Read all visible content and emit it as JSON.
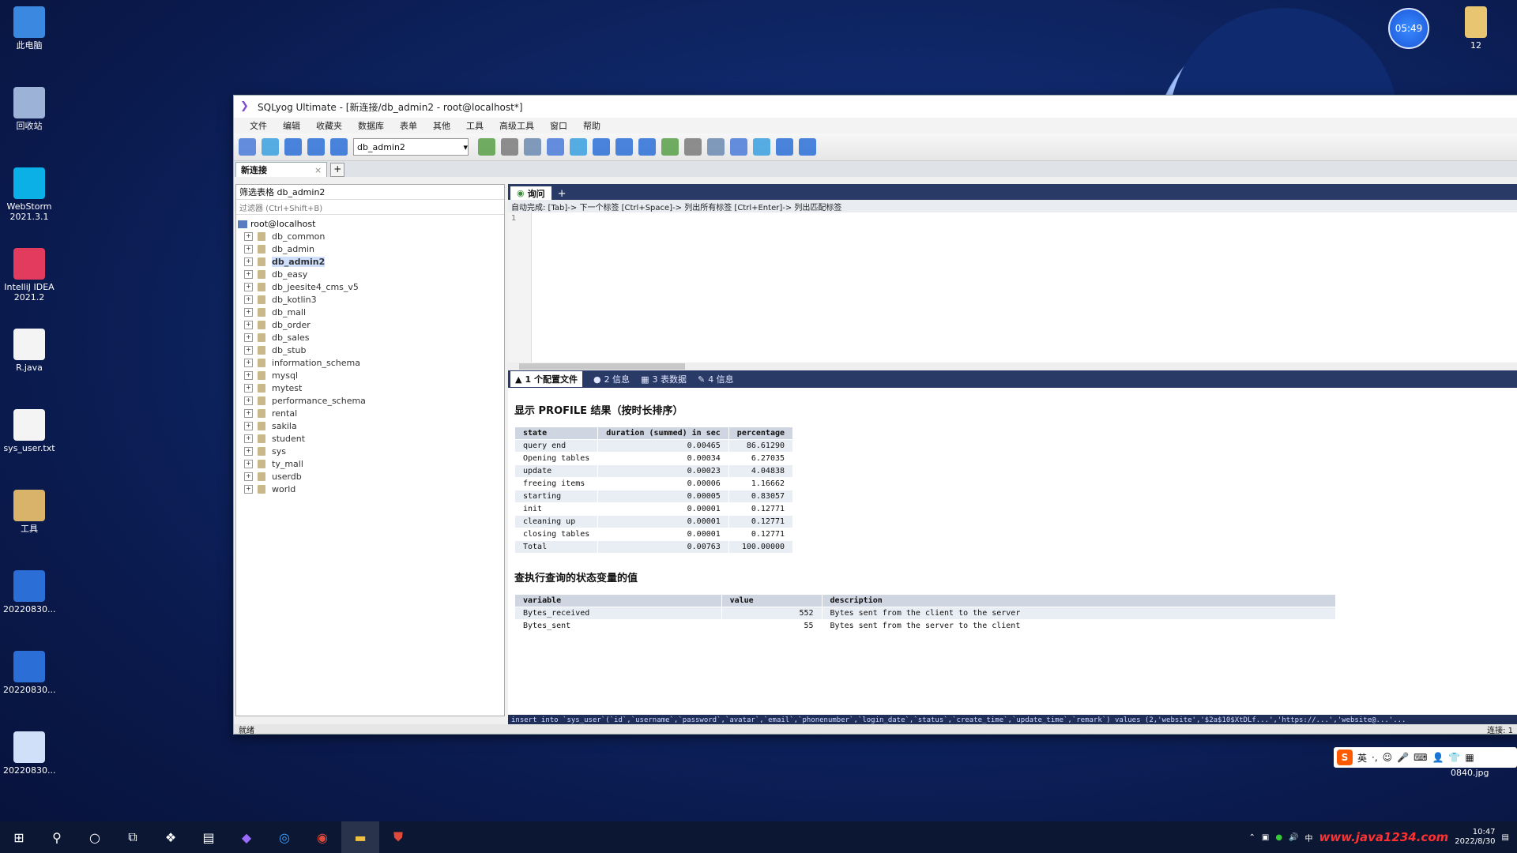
{
  "desktop": {
    "icons": [
      {
        "label": "此电脑",
        "color": "#3a88e0"
      },
      {
        "label": "回收站",
        "color": "#9cb2d6"
      },
      {
        "label": "WebStorm 2021.3.1",
        "color": "#0bb0e6"
      },
      {
        "label": "IntelliJ IDEA 2021.2",
        "color": "#e23b5d"
      },
      {
        "label": "R.java",
        "color": "#f4f4f4"
      },
      {
        "label": "sys_user.txt",
        "color": "#f4f4f4"
      },
      {
        "label": "工具",
        "color": "#d9b36a"
      },
      {
        "label": "20220830...",
        "color": "#2b6fd6"
      },
      {
        "label": "20220830...",
        "color": "#2b6fd6"
      },
      {
        "label": "20220830...",
        "color": "#cfe0f8"
      }
    ],
    "right_icon_label": "12",
    "right_icon2_label": "0840.jpg",
    "timer": "05:49"
  },
  "window": {
    "title": "SQLyog Ultimate - [新连接/db_admin2 - root@localhost*]",
    "menu": [
      "文件",
      "编辑",
      "收藏夹",
      "数据库",
      "表单",
      "其他",
      "工具",
      "高级工具",
      "窗口",
      "帮助"
    ],
    "toolbar_icons": [
      "new-connection-icon",
      "new-query-icon",
      "execute-icon",
      "execute-all-icon",
      "stop-icon",
      "refresh-icon",
      "backup-icon",
      "restore-icon",
      "import-icon",
      "export-icon",
      "schema-icon",
      "sync-icon",
      "table-icon",
      "index-icon",
      "user-icon",
      "profile-icon",
      "gear-icon",
      "log-icon",
      "grid-icon",
      "chart-icon"
    ],
    "db_select": "db_admin2",
    "connection_tab": "新连接"
  },
  "object_browser": {
    "filter_label": "筛选表格 db_admin2",
    "filter_placeholder": "过滤器 (Ctrl+Shift+B)",
    "root": "root@localhost",
    "databases": [
      "db_common",
      "db_admin",
      "db_admin2",
      "db_easy",
      "db_jeesite4_cms_v5",
      "db_kotlin3",
      "db_mall",
      "db_order",
      "db_sales",
      "db_stub",
      "information_schema",
      "mysql",
      "mytest",
      "performance_schema",
      "rental",
      "sakila",
      "student",
      "sys",
      "ty_mall",
      "userdb",
      "world"
    ],
    "selected": "db_admin2"
  },
  "query": {
    "tab_label": "询问",
    "hint": "自动完成: [Tab]-> 下一个标签 [Ctrl+Space]-> 列出所有标签 [Ctrl+Enter]-> 列出匹配标签",
    "line": "1"
  },
  "results": {
    "tabs": [
      "1 个配置文件",
      "2 信息",
      "3 表数据",
      "4 信息"
    ],
    "profile_title": "显示 PROFILE 结果（按时长排序）",
    "profile_headers": [
      "state",
      "duration (summed) in sec",
      "percentage"
    ],
    "profile_rows": [
      [
        "query end",
        "0.00465",
        "86.61290"
      ],
      [
        "Opening tables",
        "0.00034",
        "6.27035"
      ],
      [
        "update",
        "0.00023",
        "4.04838"
      ],
      [
        "freeing items",
        "0.00006",
        "1.16662"
      ],
      [
        "starting",
        "0.00005",
        "0.83057"
      ],
      [
        "init",
        "0.00001",
        "0.12771"
      ],
      [
        "cleaning up",
        "0.00001",
        "0.12771"
      ],
      [
        "closing tables",
        "0.00001",
        "0.12771"
      ],
      [
        "Total",
        "0.00763",
        "100.00000"
      ]
    ],
    "status_title": "查执行查询的状态变量的值",
    "status_headers": [
      "variable",
      "value",
      "description"
    ],
    "status_rows": [
      [
        "Bytes_received",
        "552",
        "Bytes sent from the client to the server"
      ],
      [
        "Bytes_sent",
        "55",
        "Bytes sent from the server to the client"
      ]
    ]
  },
  "cmdline": "insert into `sys_user`(`id`,`username`,`password`,`avatar`,`email`,`phonenumber`,`login_date`,`status`,`create_time`,`update_time`,`remark`) values (2,'website','$2a$10$XtDLf...','https://...','website@...'...",
  "status_bar": {
    "left": "就绪",
    "right": "连接: 1"
  },
  "taskbar": {
    "buttons": [
      "start-icon",
      "search-icon",
      "cortana-icon",
      "taskview-icon",
      "sqlyog-icon",
      "notes-icon",
      "jetbrains-icon",
      "edge-icon",
      "chrome-icon",
      "explorer-icon",
      "shield-icon"
    ],
    "watermark": "www.java1234.com",
    "time": "10:47",
    "date": "2022/8/30"
  },
  "ime": {
    "label": "英"
  }
}
